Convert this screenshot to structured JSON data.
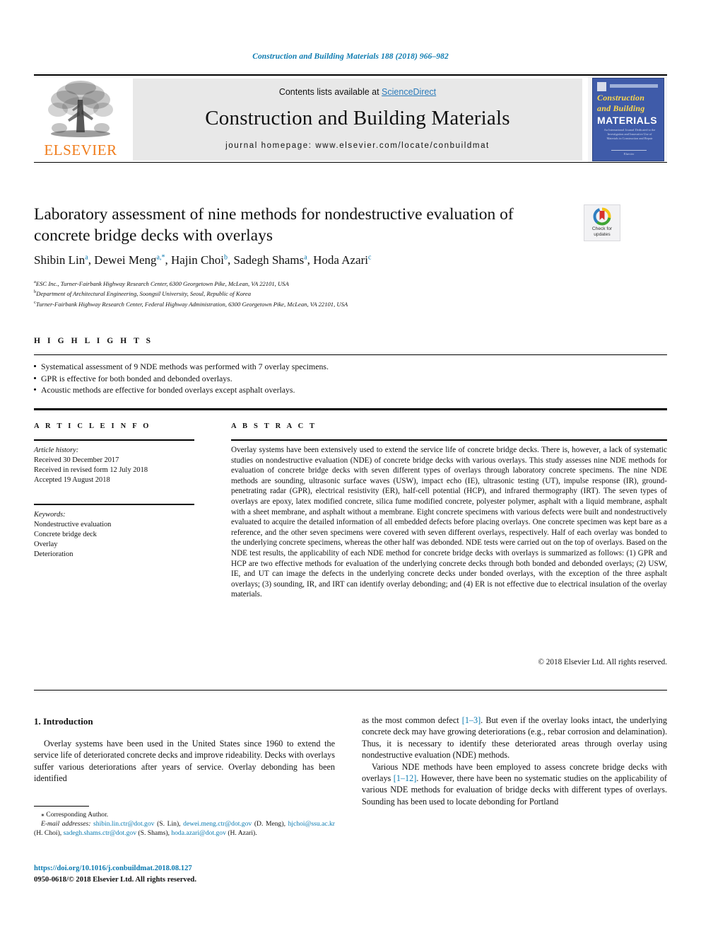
{
  "running_head": "Construction and Building Materials 188 (2018) 966–982",
  "masthead": {
    "contents_prefix": "Contents lists available at ",
    "sciencedirect": "ScienceDirect",
    "journal_title": "Construction and Building Materials",
    "homepage": "journal homepage: www.elsevier.com/locate/conbuildmat",
    "publisher": "ELSEVIER",
    "cover": {
      "line1": "Construction",
      "line2": "and Building",
      "line3": "MATERIALS",
      "subtitle": "An International Journal Dedicated to the Investigation and Innovative Use of Materials in Construction and Repair",
      "footer": "Elsevier"
    }
  },
  "article": {
    "title": "Laboratory assessment of nine methods for nondestructive evaluation of concrete bridge decks with overlays",
    "authors": [
      {
        "name": "Shibin Lin",
        "marks": "a"
      },
      {
        "name": "Dewei Meng",
        "marks": "a,*"
      },
      {
        "name": "Hajin Choi",
        "marks": "b"
      },
      {
        "name": "Sadegh Shams",
        "marks": "a"
      },
      {
        "name": "Hoda Azari",
        "marks": "c"
      }
    ],
    "affiliations": [
      {
        "mark": "a",
        "text": "ESC Inc., Turner-Fairbank Highway Research Center, 6300 Georgetown Pike, McLean, VA 22101, USA"
      },
      {
        "mark": "b",
        "text": "Department of Architectural Engineering, Soongsil University, Seoul, Republic of Korea"
      },
      {
        "mark": "c",
        "text": "Turner-Fairbank Highway Research Center, Federal Highway Administration, 6300 Georgetown Pike, McLean, VA 22101, USA"
      }
    ]
  },
  "crossmark": {
    "line1": "Check for",
    "line2": "updates"
  },
  "highlights": {
    "heading": "H I G H L I G H T S",
    "items": [
      "Systematical assessment of 9 NDE methods was performed with 7 overlay specimens.",
      "GPR is effective for both bonded and debonded overlays.",
      "Acoustic methods are effective for bonded overlays except asphalt overlays."
    ]
  },
  "article_info": {
    "heading": "A R T I C L E   I N F O",
    "history_label": "Article history:",
    "history": [
      "Received 30 December 2017",
      "Received in revised form 12 July 2018",
      "Accepted 19 August 2018"
    ],
    "keywords_label": "Keywords:",
    "keywords": [
      "Nondestructive evaluation",
      "Concrete bridge deck",
      "Overlay",
      "Deterioration"
    ]
  },
  "abstract": {
    "heading": "A B S T R A C T",
    "body": "Overlay systems have been extensively used to extend the service life of concrete bridge decks. There is, however, a lack of systematic studies on nondestructive evaluation (NDE) of concrete bridge decks with various overlays. This study assesses nine NDE methods for evaluation of concrete bridge decks with seven different types of overlays through laboratory concrete specimens. The nine NDE methods are sounding, ultrasonic surface waves (USW), impact echo (IE), ultrasonic testing (UT), impulse response (IR), ground-penetrating radar (GPR), electrical resistivity (ER), half-cell potential (HCP), and infrared thermography (IRT). The seven types of overlays are epoxy, latex modified concrete, silica fume modified concrete, polyester polymer, asphalt with a liquid membrane, asphalt with a sheet membrane, and asphalt without a membrane. Eight concrete specimens with various defects were built and nondestructively evaluated to acquire the detailed information of all embedded defects before placing overlays. One concrete specimen was kept bare as a reference, and the other seven specimens were covered with seven different overlays, respectively. Half of each overlay was bonded to the underlying concrete specimens, whereas the other half was debonded. NDE tests were carried out on the top of overlays. Based on the NDE test results, the applicability of each NDE method for concrete bridge decks with overlays is summarized as follows: (1) GPR and HCP are two effective methods for evaluation of the underlying concrete decks through both bonded and debonded overlays; (2) USW, IE, and UT can image the defects in the underlying concrete decks under bonded overlays, with the exception of the three asphalt overlays; (3) sounding, IR, and IRT can identify overlay debonding; and (4) ER is not effective due to electrical insulation of the overlay materials.",
    "copyright": "© 2018 Elsevier Ltd. All rights reserved."
  },
  "body": {
    "section_heading": "1. Introduction",
    "left_para1": "Overlay systems have been used in the United States since 1960 to extend the service life of deteriorated concrete decks and improve rideability. Decks with overlays suffer various deteriorations after years of service. Overlay debonding has been identified",
    "right_para1_head": "as the most common defect ",
    "right_para1_ref": "[1–3]",
    "right_para1_tail": ". But even if the overlay looks intact, the underlying concrete deck may have growing deteriorations (e.g., rebar corrosion and delamination). Thus, it is necessary to identify these deteriorated areas through overlay using nondestructive evaluation (NDE) methods.",
    "right_para2_head": "Various NDE methods have been employed to assess concrete bridge decks with overlays ",
    "right_para2_ref": "[1–12]",
    "right_para2_tail": ". However, there have been no systematic studies on the applicability of various NDE methods for evaluation of bridge decks with different types of overlays. Sounding has been used to locate debonding for Portland"
  },
  "footnote": {
    "corresponding": "⁎ Corresponding Author.",
    "email_label": "E-mail addresses:",
    "emails": [
      {
        "address": "shibin.lin.ctr@dot.gov",
        "who": "(S. Lin)"
      },
      {
        "address": "dewei.meng.ctr@dot.gov",
        "who": "(D. Meng)"
      },
      {
        "address": "hjchoi@ssu.ac.kr",
        "who": "(H. Choi)"
      },
      {
        "address": "sadegh.shams.ctr@dot.gov",
        "who": "(S. Shams)"
      },
      {
        "address": "hoda.azari@dot.gov",
        "who": "(H. Azari)"
      }
    ],
    "doi": "https://doi.org/10.1016/j.conbuildmat.2018.08.127",
    "issn_line": "0950-0618/© 2018 Elsevier Ltd. All rights reserved."
  },
  "colors": {
    "link": "#0b7ab0",
    "sciencedirect": "#2a7ab9",
    "elsevier_orange": "#f07c1b",
    "cover_blue": "#3f5ba9",
    "cover_yellow": "#ffd94a"
  }
}
